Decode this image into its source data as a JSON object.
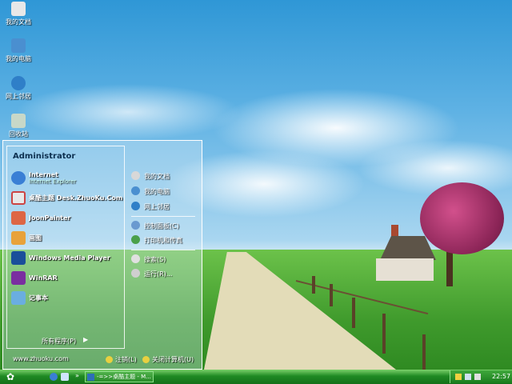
{
  "desktop": {
    "icons": [
      {
        "label": "我的文档",
        "icon": "my-documents-icon",
        "color": "#e8e8e8"
      },
      {
        "label": "我的电脑",
        "icon": "my-computer-icon",
        "color": "#4a8fd0"
      },
      {
        "label": "网上邻居",
        "icon": "network-icon",
        "color": "#2f7fc8"
      },
      {
        "label": "回收站",
        "icon": "recycle-bin-icon",
        "color": "#c8d8c8"
      }
    ]
  },
  "start_menu": {
    "user": "Administrator",
    "pinned": [
      {
        "label": "Internet",
        "sub": "Internet Explorer",
        "icon": "internet-explorer-icon",
        "color": "#3a7fd5"
      },
      {
        "label": "桌酷主题 Desk.ZhuoKu.Com",
        "sub": "",
        "icon": "zhuoku-icon",
        "color": "#c44"
      }
    ],
    "recent": [
      {
        "label": "JoonPainter",
        "icon": "painter-icon",
        "color": "#d64"
      },
      {
        "label": "画图",
        "icon": "paint-icon",
        "color": "#e8a23a"
      },
      {
        "label": "Windows Media Player",
        "icon": "media-player-icon",
        "color": "#1a4f9a"
      },
      {
        "label": "WinRAR",
        "icon": "winrar-icon",
        "color": "#7a2fa0"
      },
      {
        "label": "记事本",
        "icon": "notepad-icon",
        "color": "#6aaee0"
      }
    ],
    "all_programs": "所有程序(P)",
    "right": [
      {
        "label": "我的文档",
        "icon": "documents-icon",
        "color": "#d8d8d8"
      },
      {
        "label": "我的电脑",
        "icon": "computer-icon",
        "color": "#4a8fd0"
      },
      {
        "label": "网上邻居",
        "icon": "network-places-icon",
        "color": "#2f7fc8"
      },
      {
        "label": "控制面板(C)",
        "icon": "control-panel-icon",
        "color": "#6a9ad0"
      },
      {
        "label": "打印机和传真",
        "icon": "printer-icon",
        "color": "#4aa04a"
      },
      {
        "label": "搜索(S)",
        "icon": "search-icon",
        "color": "#e0e0e0"
      },
      {
        "label": "运行(R)...",
        "icon": "run-icon",
        "color": "#cfcfcf"
      }
    ],
    "url": "www.zhuoku.com",
    "logoff": "注销(L)",
    "shutdown": "关闭计算机(U)"
  },
  "taskbar": {
    "start_icon": "start-flower-icon",
    "quick_launch": [
      {
        "icon": "ie-quick-icon",
        "color": "#3a7fd5"
      },
      {
        "icon": "desktop-quick-icon",
        "color": "#cfe4ff"
      },
      {
        "icon": "media-quick-icon",
        "color": "#f0b030"
      }
    ],
    "task": "-=>>桌酷主题 - M...",
    "clock": "22:57"
  }
}
